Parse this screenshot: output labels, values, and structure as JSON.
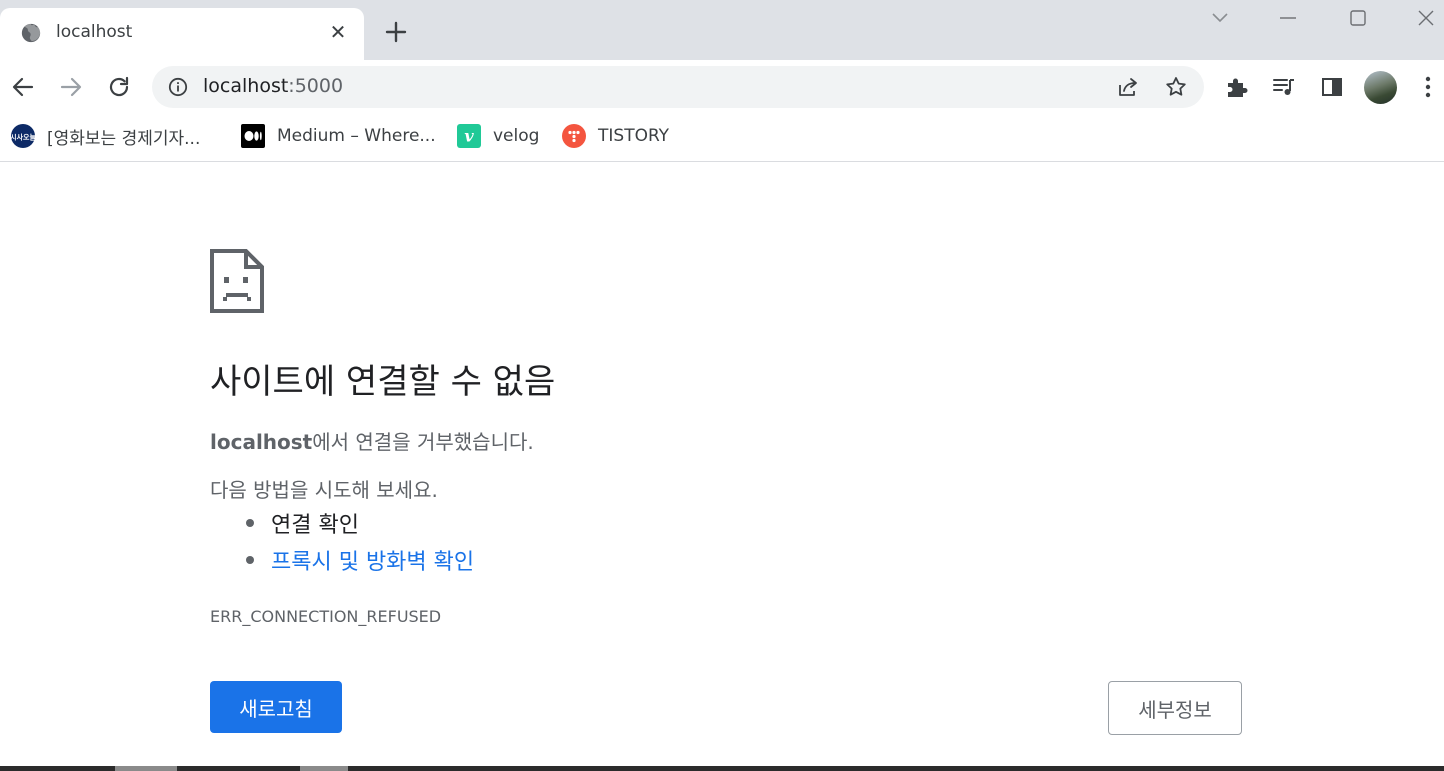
{
  "tab": {
    "title": "localhost",
    "close_symbol": "✕"
  },
  "omnibox": {
    "host": "localhost",
    "port": ":5000"
  },
  "bookmarks": [
    {
      "label": "[영화보는 경제기자...",
      "icon": "sisa-icon",
      "favicon_text": "시사오늘",
      "color": "#0d2a66"
    },
    {
      "label": "Medium – Where...",
      "icon": "medium-icon",
      "color": "#000000"
    },
    {
      "label": "velog",
      "icon": "velog-icon",
      "favicon_text": "v",
      "color": "#20c997"
    },
    {
      "label": "TISTORY",
      "icon": "tistory-icon",
      "color": "#f4553f"
    }
  ],
  "error": {
    "title": "사이트에 연결할 수 없음",
    "host": "localhost",
    "message": "에서 연결을 거부했습니다.",
    "try_text": "다음 방법을 시도해 보세요.",
    "suggestions": [
      "연결 확인",
      "프록시 및 방화벽 확인"
    ],
    "code": "ERR_CONNECTION_REFUSED"
  },
  "buttons": {
    "reload": "새로고침",
    "details": "세부정보"
  },
  "colors": {
    "accent": "#1a73e8",
    "tabstrip": "#dee1e6",
    "omnibox": "#f1f3f4"
  }
}
